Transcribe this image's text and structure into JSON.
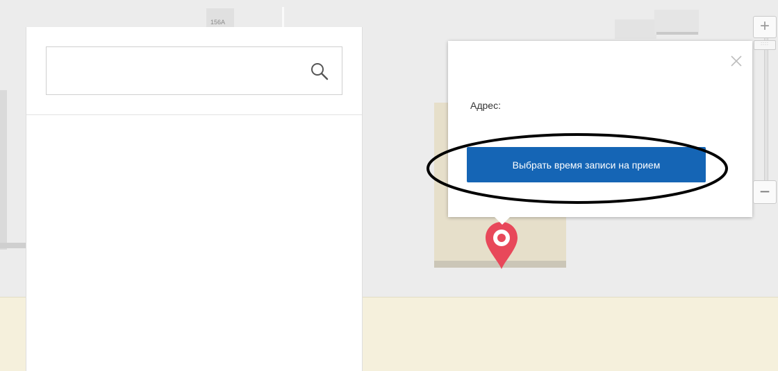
{
  "map": {
    "building_label": "156A"
  },
  "search": {
    "value": "",
    "placeholder": "",
    "icon": "search-icon"
  },
  "popup": {
    "address_label": "Адрес:",
    "button_label": "Выбрать время записи на прием",
    "close_icon": "close-icon"
  },
  "zoom": {
    "in_label": "+",
    "out_label": "−",
    "handle_label": "::::"
  },
  "colors": {
    "button": "#1565b5",
    "marker": "#e8485a",
    "parcel": "#e6dfca",
    "road": "#f5f0dc"
  }
}
